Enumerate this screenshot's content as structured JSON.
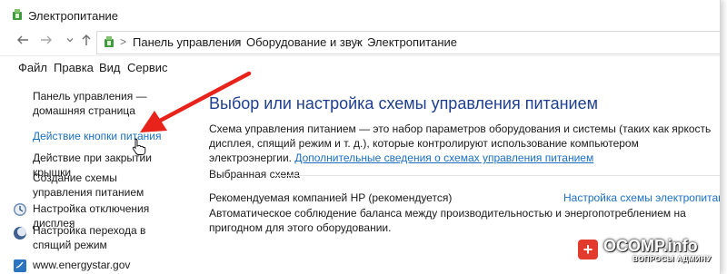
{
  "window": {
    "title": "Электропитание"
  },
  "nav": {
    "back_icon": "arrow-left-icon",
    "forward_icon": "arrow-right-icon",
    "recent_icon": "chevron-down-icon",
    "up_icon": "arrow-up-icon"
  },
  "breadcrumb": {
    "items": [
      "Панель управления",
      "Оборудование и звук",
      "Электропитание"
    ],
    "separator": ">"
  },
  "menu": {
    "items": [
      "Файл",
      "Правка",
      "Вид",
      "Сервис"
    ]
  },
  "sidebar": {
    "items": [
      {
        "label": "Панель управления — домашняя страница"
      },
      {
        "label": "Действие кнопки питания"
      },
      {
        "label": "Действие при закрытии крышки"
      },
      {
        "label": "Создание схемы управления питанием"
      },
      {
        "label": "Настройка отключения дисплея"
      },
      {
        "label": "Настройка перехода в спящий режим"
      },
      {
        "label": "www.energystar.gov"
      }
    ]
  },
  "main": {
    "heading": "Выбор или настройка схемы управления питанием",
    "description": "Схема управления питанием — это набор параметров оборудования и системы (таких как яркость дисплея, спящий режим и т. д.), которые контролируют использование компьютером электроэнергии.",
    "more_link": "Дополнительные сведения о схемах управления питанием",
    "selected_header": "Выбранная схема",
    "plan": {
      "name": "Рекомендуемая компанией HP (рекомендуется)",
      "settings_link": "Настройка схемы электропитания",
      "description": "Автоматическое соблюдение баланса между производительностью и энергопотреблением на пригодном для этого оборудовании."
    }
  },
  "watermark": {
    "badge": "+",
    "main": "OCOMP.info",
    "sub": "ВОПРОСЫ АДМИНУ"
  },
  "colors": {
    "link": "#1a6fc2",
    "heading": "#1e3f8f",
    "annotation_arrow": "#e8231b"
  }
}
